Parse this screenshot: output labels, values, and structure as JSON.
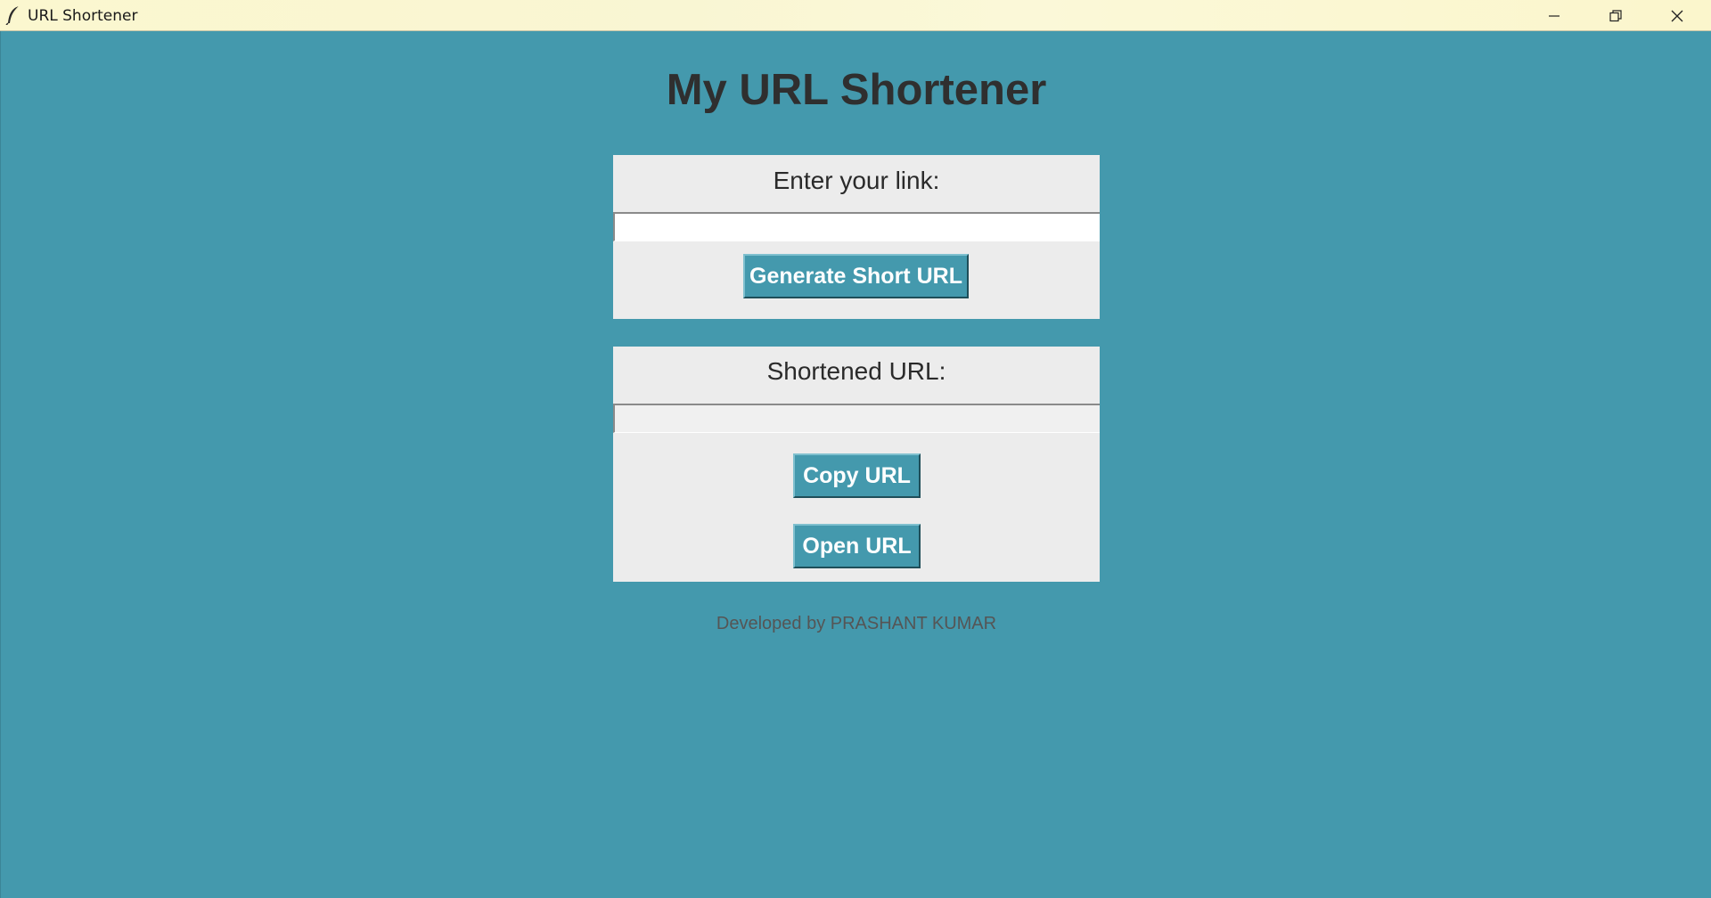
{
  "window": {
    "title": "URL Shortener",
    "icon": "feather-icon",
    "controls": {
      "minimize": "minimize-icon",
      "restore": "restore-icon",
      "close": "close-icon"
    }
  },
  "app": {
    "heading": "My URL Shortener",
    "input_panel": {
      "label": "Enter your link:",
      "input_value": "",
      "button_label": "Generate Short URL"
    },
    "output_panel": {
      "label": "Shortened URL:",
      "output_value": "",
      "copy_label": "Copy URL",
      "open_label": "Open URL"
    },
    "footer": "Developed by PRASHANT KUMAR"
  },
  "colors": {
    "background": "#4499ad",
    "panel": "#ececec",
    "button": "#4499ad",
    "button_text": "#ffffff",
    "heading_text": "#2f2f2f",
    "footer_text": "#555555",
    "titlebar": "#fbf7cf"
  }
}
